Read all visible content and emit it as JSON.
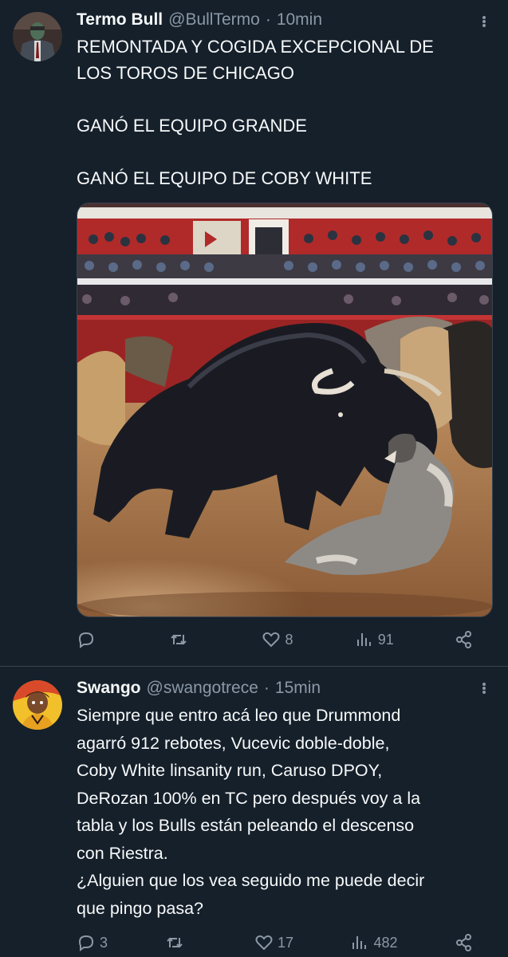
{
  "tweets": [
    {
      "display_name": "Termo Bull",
      "handle": "@BullTermo",
      "separator": "·",
      "time": "10min",
      "text": "REMONTADA Y COGIDA EXCEPCIONAL DE\nLOS TOROS DE CHICAGO\n\nGANÓ EL EQUIPO GRANDE\n\nGANÓ EL EQUIPO DE COBY WHITE",
      "actions": {
        "replies": "",
        "retweets": "",
        "likes": "8",
        "views": "91"
      }
    },
    {
      "display_name": "Swango",
      "handle": "@swangotrece",
      "separator": "·",
      "time": "15min",
      "text": "Siempre que entro acá leo que Drummond\nagarró 912 rebotes, Vucevic doble-doble,\nCoby White linsanity run, Caruso DPOY,\nDeRozan 100% en TC pero después voy a la\ntabla y los Bulls están peleando el descenso\ncon Riestra.\n¿Alguien que los vea seguido me puede decir\nque pingo pasa?",
      "actions": {
        "replies": "3",
        "retweets": "",
        "likes": "17",
        "views": "482"
      }
    }
  ],
  "icons": {
    "reply": "reply-icon",
    "retweet": "retweet-icon",
    "like": "heart-icon",
    "views": "views-icon",
    "share": "share-icon",
    "more": "more-icon"
  },
  "colors": {
    "background": "#15202b",
    "text": "#f7f9f9",
    "secondary": "#8b98a5",
    "border": "#38444d"
  }
}
